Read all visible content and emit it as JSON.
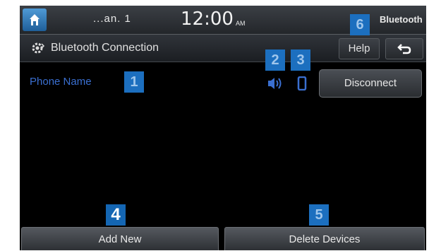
{
  "status_bar": {
    "signal": "...an. 1",
    "clock": "12:00",
    "ampm": "AM",
    "bluetooth_indicator": "Bluetooth"
  },
  "title_bar": {
    "title": "Bluetooth Connection",
    "help_label": "Help"
  },
  "device": {
    "phone_name": "Phone Name",
    "disconnect_label": "Disconnect"
  },
  "bottom": {
    "add_new_label": "Add New",
    "delete_devices_label": "Delete Devices"
  },
  "callouts": {
    "phone_name": "1",
    "audio_icon": "2",
    "handsfree_icon": "3",
    "add_new": "4",
    "delete_devices": "5",
    "help": "6"
  },
  "icons": {
    "home": "home-icon",
    "title": "bluetooth-settings-icon",
    "back": "back-arrow-icon",
    "audio": "bluetooth-audio-icon",
    "handsfree": "phone-icon"
  },
  "colors": {
    "phone_name": "#3a6fd0",
    "callout": "#1c6fbf",
    "screen_bg": "#000000"
  }
}
